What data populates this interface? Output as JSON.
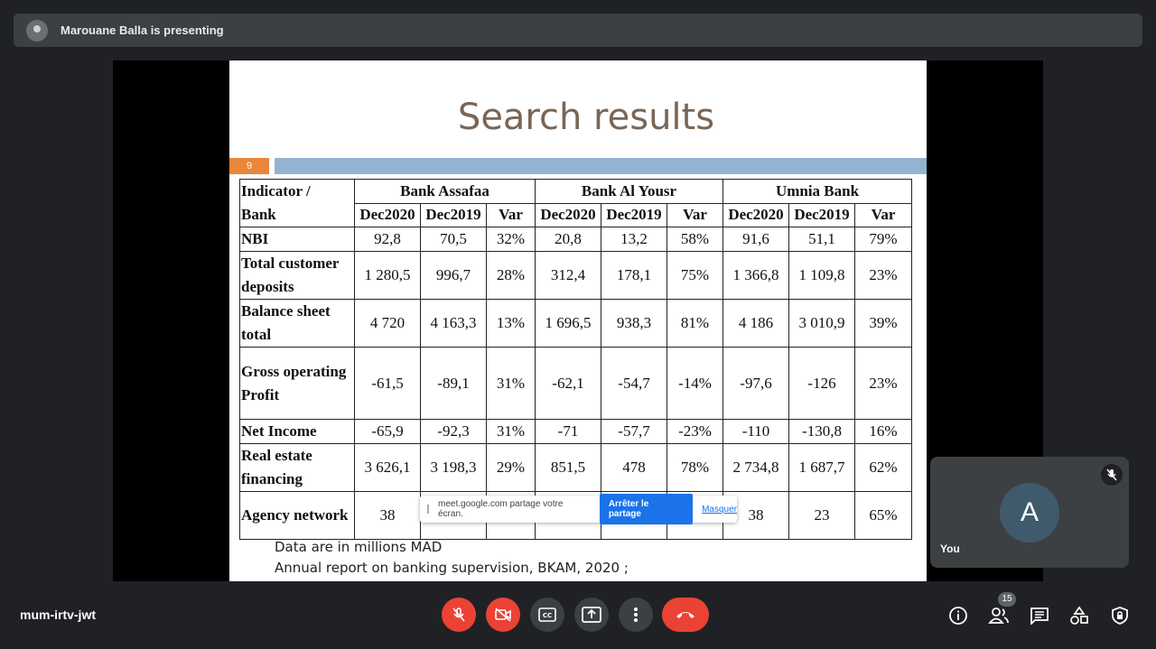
{
  "presenter": {
    "text": "Marouane Balla is presenting"
  },
  "slide": {
    "title": "Search results",
    "number": "9",
    "headers": {
      "indicator_line1": "Indicator /",
      "indicator_line2": "Bank",
      "bank1": "Bank Assafaa",
      "bank2": "Bank Al Yousr",
      "bank3": "Umnia Bank",
      "col_dec2020": "Dec2020",
      "col_dec2019": "Dec2019",
      "col_var": "Var"
    },
    "rows": [
      {
        "label": "NBI",
        "values": [
          "92,8",
          "70,5",
          "32%",
          "20,8",
          "13,2",
          "58%",
          "91,6",
          "51,1",
          "79%"
        ]
      },
      {
        "label": "Total customer deposits",
        "values": [
          "1 280,5",
          "996,7",
          "28%",
          "312,4",
          "178,1",
          "75%",
          "1 366,8",
          "1 109,8",
          "23%"
        ]
      },
      {
        "label": "Balance sheet total",
        "values": [
          "4 720",
          "4 163,3",
          "13%",
          "1 696,5",
          "938,3",
          "81%",
          "4 186",
          "3 010,9",
          "39%"
        ]
      },
      {
        "label": "Gross operating Profit",
        "values": [
          "-61,5",
          "-89,1",
          "31%",
          "-62,1",
          "-54,7",
          "-14%",
          "-97,6",
          "-126",
          "23%"
        ]
      },
      {
        "label": "Net Income",
        "values": [
          "-65,9",
          "-92,3",
          "31%",
          "-71",
          "-57,7",
          "-23%",
          "-110",
          "-130,8",
          "16%"
        ]
      },
      {
        "label": "Real estate financing",
        "values": [
          "3 626,1",
          "3 198,3",
          "29%",
          "851,5",
          "478",
          "78%",
          "2 734,8",
          "1 687,7",
          "62%"
        ]
      },
      {
        "label": "Agency network",
        "values": [
          "38",
          "",
          "",
          "",
          "",
          "",
          "38",
          "23",
          "65%"
        ]
      }
    ],
    "footnote1": "Data are in millions MAD",
    "footnote2": "Annual report on banking supervision, BKAM, 2020 ;"
  },
  "share_banner": {
    "message": "meet.google.com partage votre écran.",
    "stop_label": "Arrêter le partage",
    "hide_label": "Masquer"
  },
  "self_tile": {
    "avatar_letter": "A",
    "name": "You",
    "mic_state": "muted",
    "icon": "mic-off-icon"
  },
  "bottom_bar": {
    "meeting_code": "mum-irtv-jwt",
    "participants_count": "15",
    "controls": [
      "mic-off-icon",
      "camera-off-icon",
      "captions-icon",
      "present-icon",
      "more-icon",
      "hangup-icon"
    ],
    "right_icons": [
      "info-icon",
      "people-icon",
      "chat-icon",
      "activities-icon",
      "host-controls-icon"
    ]
  },
  "colors": {
    "background": "#202124",
    "panel": "#3c4043",
    "danger": "#ea4335",
    "accent": "#1a73e8",
    "slide_title": "#7b6655",
    "slide_number_bar": "#e9863a",
    "slide_header_bar": "#92b4d2"
  }
}
